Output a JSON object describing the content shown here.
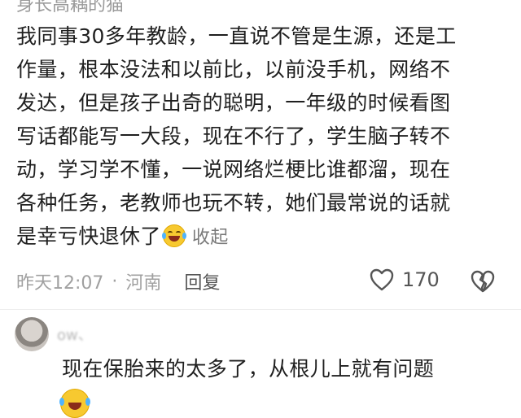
{
  "comment": {
    "author": "身长高耦的猫",
    "lines": [
      "我同事30多年教龄，一直说不管是生源，还是工",
      "作量，根本没法和以前比，以前没手机，网络不",
      "发达，但是孩子出奇的聪明，一年级的时候看图",
      "写话都能写一大段，现在不行了，学生脑子转不",
      "动，学习学不懂，一说网络烂梗比谁都溜，现在",
      "各种任务，老教师也玩不转，她们最常说的话就"
    ],
    "last_line": "是幸亏快退休了",
    "emoji": "laughing-crying-emoji",
    "collapse_label": "收起",
    "time": "昨天12:07",
    "separator": "·",
    "location": "河南",
    "reply_label": "回复",
    "like_count": "170"
  },
  "reply": {
    "username": "ow、",
    "text": "现在保胎来的太多了，从根儿上就有问题",
    "emoji": "laughing-crying-emoji"
  },
  "colors": {
    "text": "#1f1f1f",
    "meta": "#a0a0a0",
    "divider": "#ececec"
  }
}
